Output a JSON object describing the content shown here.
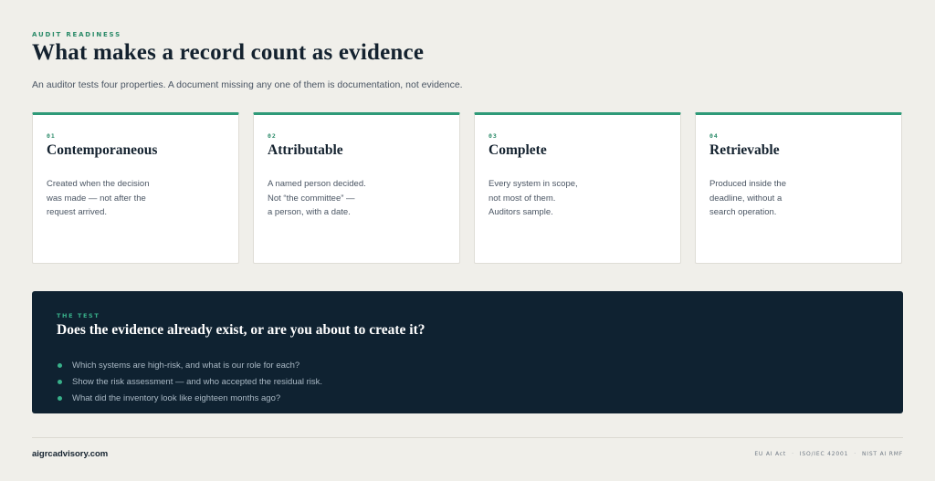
{
  "header": {
    "eyebrow": "AUDIT READINESS",
    "title": "What makes a record count as evidence",
    "subtitle": "An auditor tests four properties. A document missing any one of them is documentation, not evidence."
  },
  "cards": [
    {
      "number": "01",
      "title": "Contemporaneous",
      "lines": [
        "Created when the decision",
        "was made — not after the",
        "request arrived."
      ]
    },
    {
      "number": "02",
      "title": "Attributable",
      "lines": [
        "A named person decided.",
        "Not “the committee” —",
        "a person, with a date."
      ]
    },
    {
      "number": "03",
      "title": "Complete",
      "lines": [
        "Every system in scope,",
        "not most of them.",
        "Auditors sample."
      ]
    },
    {
      "number": "04",
      "title": "Retrievable",
      "lines": [
        "Produced inside the",
        "deadline, without a",
        "search operation."
      ]
    }
  ],
  "test": {
    "label": "THE TEST",
    "question": "Does the evidence already exist, or are you about to create it?",
    "items": [
      "Which systems are high-risk, and what is our role for each?",
      "Show the risk assessment — and who accepted the residual risk.",
      "What did the inventory look like eighteen months ago?"
    ]
  },
  "footer": {
    "site": "aigrcadvisory.com",
    "refs": [
      "EU AI Act",
      "ISO/IEC 42001",
      "NIST AI RMF"
    ],
    "separator": "·"
  },
  "colors": {
    "accent": "#2e9a78",
    "panel": "#0f2231",
    "background": "#f0efea"
  }
}
